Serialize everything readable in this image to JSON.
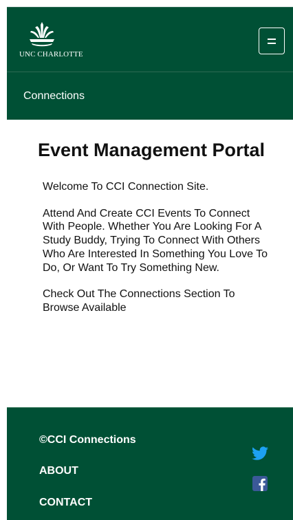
{
  "header": {
    "logo_text": "UNC CHARLOTTE",
    "menu_icon": "hamburger-menu-icon"
  },
  "subnav": {
    "link": "Connections"
  },
  "main": {
    "title": "Event Management Portal",
    "paragraphs": [
      "Welcome To CCI Connection Site.",
      "Attend And Create CCI Events To Connect With People. Whether You Are Looking For A Study Buddy, Trying To Connect With Others Who Are Interested In Something You Love To Do, Or Want To Try Something New.",
      "Check Out The Connections Section To Browse Available"
    ]
  },
  "footer": {
    "copyright": "©CCI Connections",
    "about": "ABOUT",
    "contact": "CONTACT",
    "social": [
      "twitter-icon",
      "facebook-icon"
    ]
  },
  "colors": {
    "brand_green": "#005035",
    "twitter_blue": "#1da1f2",
    "facebook_blue": "#3b5998"
  }
}
